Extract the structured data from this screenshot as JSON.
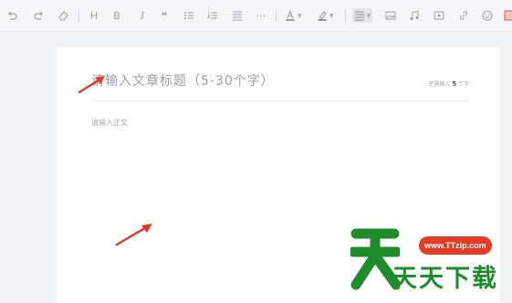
{
  "toolbar": {
    "text_buttons": {
      "heading": "H",
      "bold": "B",
      "italic": "I",
      "quote": "❝",
      "more": "···"
    }
  },
  "editor": {
    "title_placeholder": "请输入文章标题（5-30个字）",
    "counter_prefix": "还需输入",
    "counter_value": "5",
    "counter_suffix": "个字",
    "body_placeholder": "请输入正文"
  },
  "watermark": {
    "logo_text": "天天下载",
    "url": "www.TTzip.com"
  },
  "colors": {
    "arrow": "#e0392b",
    "watermark_green": "#1e8c2b",
    "watermark_red": "#e33b25"
  }
}
